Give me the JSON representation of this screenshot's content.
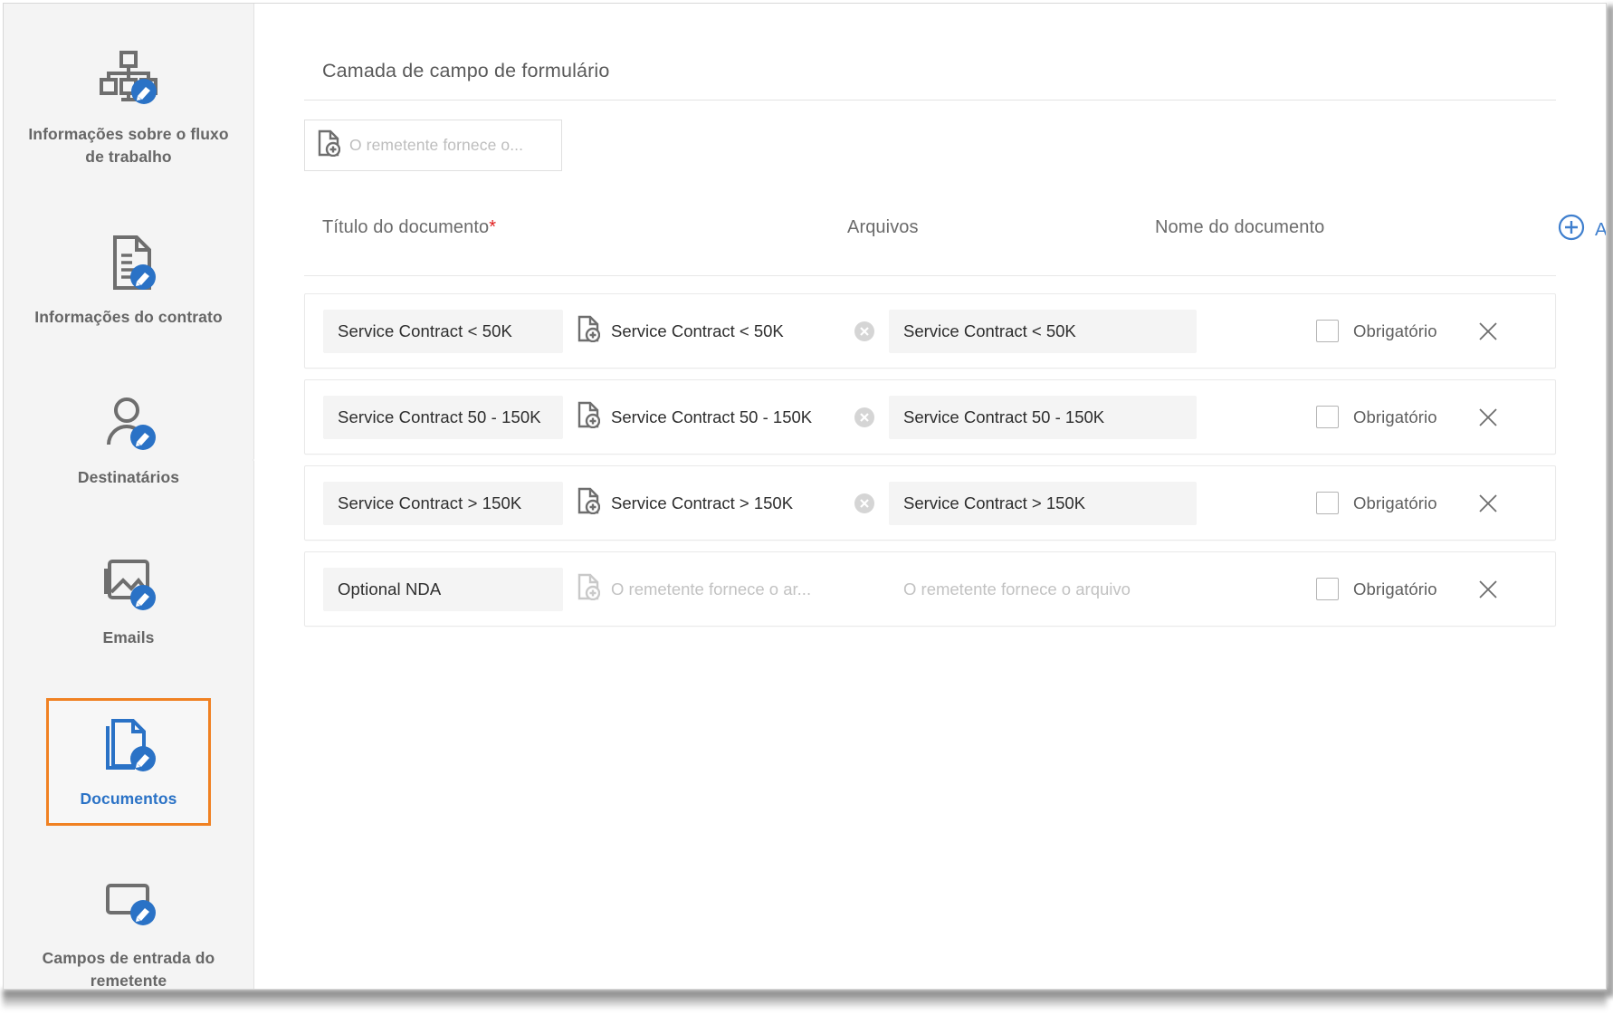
{
  "sidebar": {
    "items": [
      {
        "label": "Informações sobre o fluxo de trabalho",
        "icon": "workflow-edit-icon",
        "selected": false
      },
      {
        "label": "Informações do contrato",
        "icon": "document-edit-icon",
        "selected": false
      },
      {
        "label": "Destinatários",
        "icon": "user-edit-icon",
        "selected": false
      },
      {
        "label": "Emails",
        "icon": "image-mail-edit-icon",
        "selected": false
      },
      {
        "label": "Documentos",
        "icon": "documents-edit-icon",
        "selected": true
      },
      {
        "label": "Campos de entrada do remetente",
        "icon": "input-field-edit-icon",
        "selected": false
      }
    ]
  },
  "main": {
    "section_title": "Camada de campo de formulário",
    "layer_field": {
      "placeholder": "O remetente fornece o...",
      "icon": "file-add-icon"
    },
    "columns": {
      "title": "Título do documento",
      "title_required_mark": "*",
      "files": "Arquivos",
      "name": "Nome do documento"
    },
    "add_document": {
      "label": "Adicionar documento",
      "icon": "plus-circle-icon"
    },
    "required_label": "Obrigatório",
    "empty_file_placeholder": "O remetente fornece o ar...",
    "empty_name_placeholder": "O remetente fornece o arquivo",
    "rows": [
      {
        "title": "Service Contract  <  50K",
        "file": "Service Contract  <  50K",
        "name": "Service Contract  <  50K",
        "has_file": true,
        "required_checked": false
      },
      {
        "title": "Service Contract 50 - 150K",
        "file": "Service Contract 50 - 150K",
        "name": "Service Contract 50 - 150K",
        "has_file": true,
        "required_checked": false
      },
      {
        "title": "Service Contract  >  150K",
        "file": "Service Contract  >  150K",
        "name": "Service Contract  >  150K",
        "has_file": true,
        "required_checked": false
      },
      {
        "title": "Optional NDA",
        "file": "",
        "name": "",
        "has_file": false,
        "required_checked": false
      }
    ]
  },
  "colors": {
    "accent_blue": "#3f7fce",
    "selected_border_orange": "#f08122",
    "icon_gray": "#6e6e6e",
    "required_red": "#e02020",
    "sidebar_bg": "#f4f4f4"
  }
}
